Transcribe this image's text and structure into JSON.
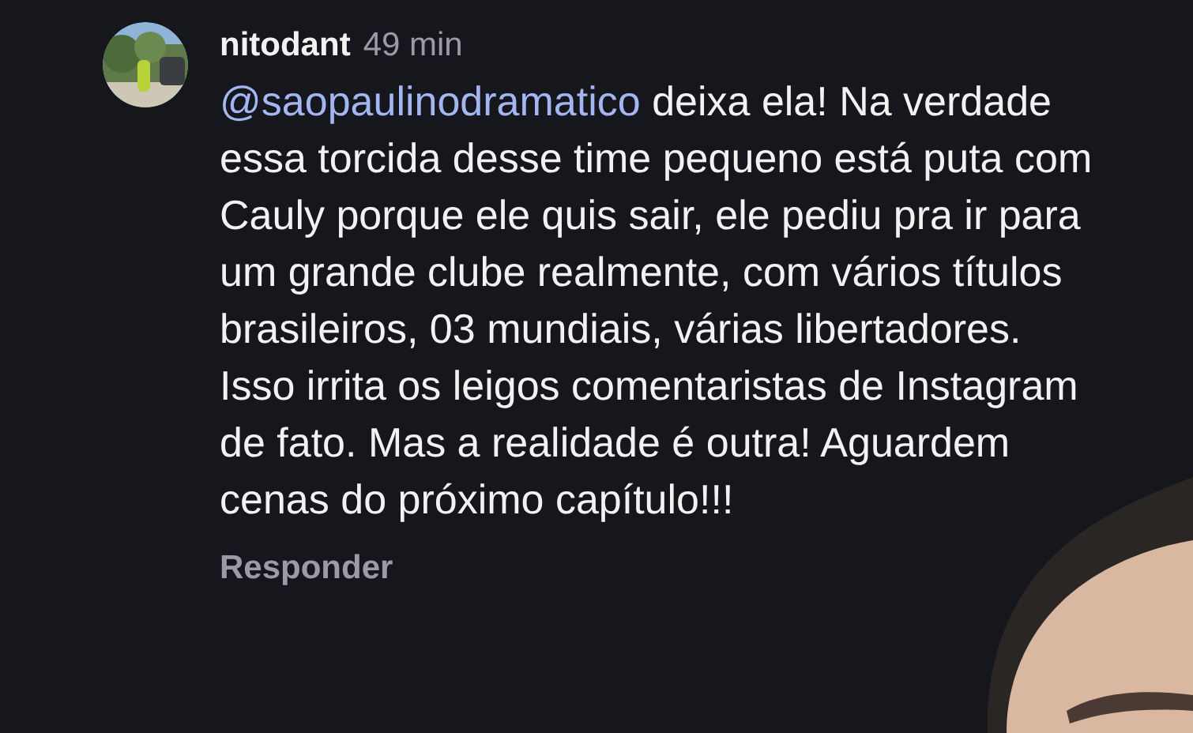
{
  "comment": {
    "username": "nitodant",
    "time": "49 min",
    "mention": "@saopaulinodramatico",
    "text": "deixa ela! Na verdade essa torcida desse time pequeno está puta com Cauly porque ele quis sair, ele pediu pra ir para um grande clube realmente, com vários títulos brasileiros, 03 mundiais, várias libertadores. Isso irrita os leigos comentaristas de Instagram de fato. Mas a realidade é outra! Aguardem cenas do próximo capítulo!!!",
    "reply": "Responder"
  }
}
